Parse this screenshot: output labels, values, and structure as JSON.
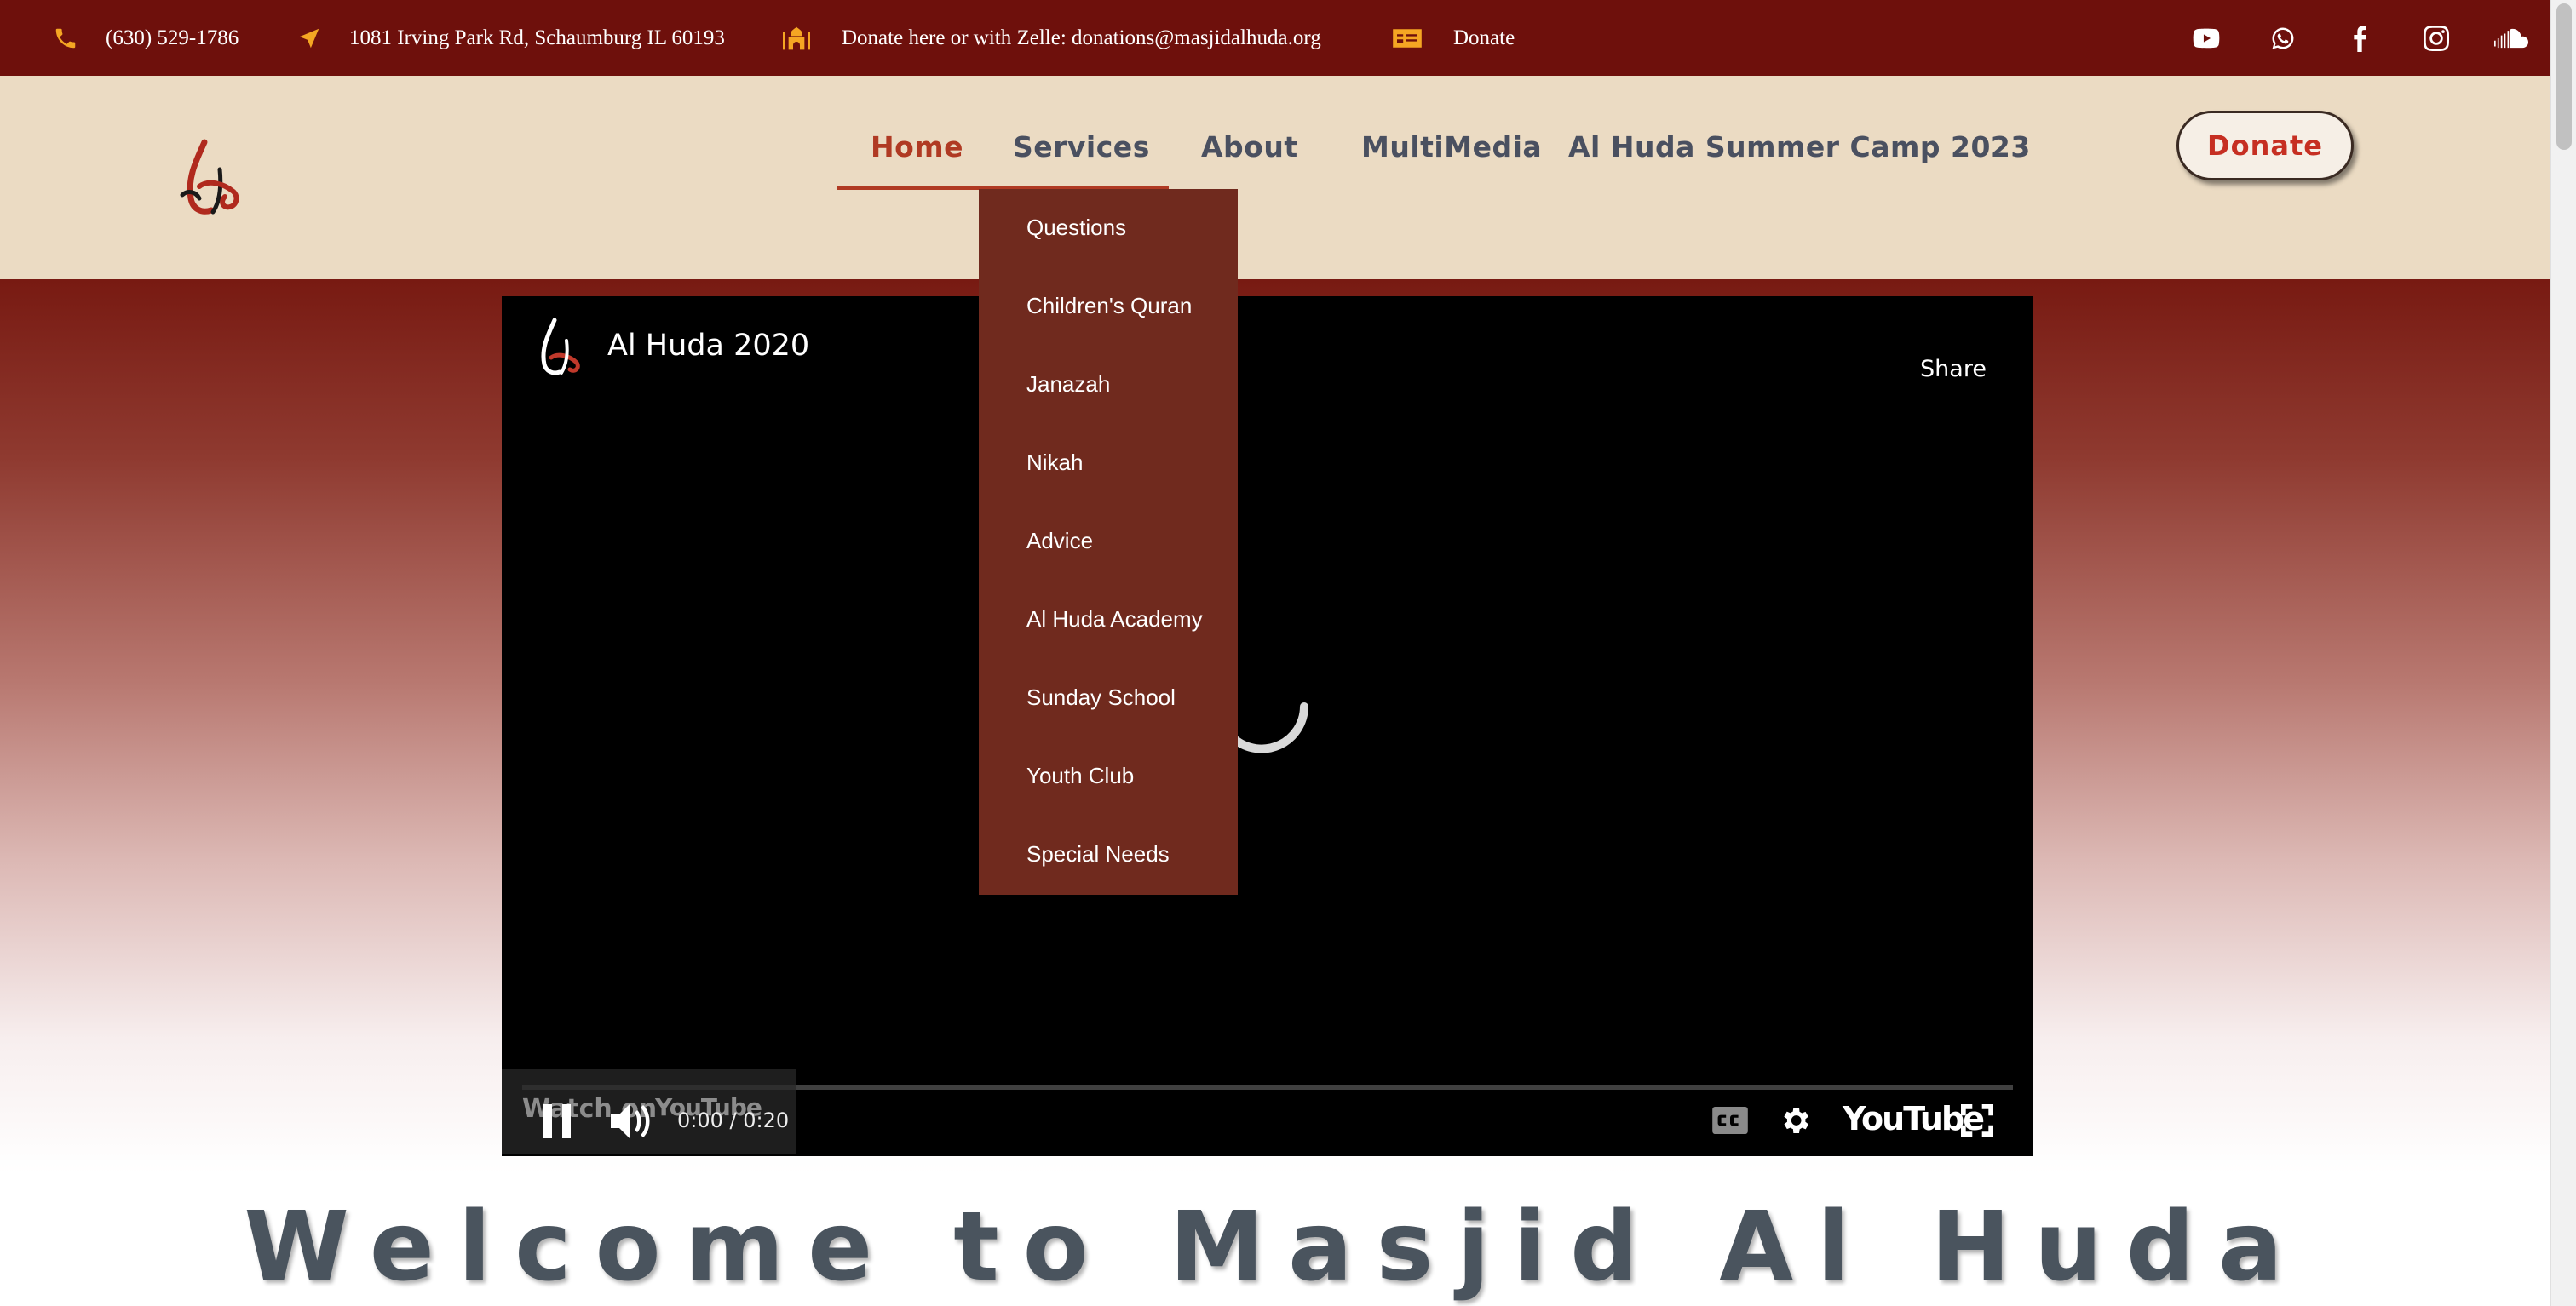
{
  "topbar": {
    "phone": "(630) 529-1786",
    "address": "1081 Irving Park Rd, Schaumburg IL 60193",
    "donate_zelle": "Donate here or with Zelle: donations@masjidalhuda.org",
    "donate_link": "Donate",
    "icons": [
      "phone-icon",
      "location-arrow-icon",
      "mosque-icon",
      "donate-card-icon"
    ],
    "social": [
      "youtube-icon",
      "whatsapp-icon",
      "facebook-icon",
      "instagram-icon",
      "soundcloud-icon"
    ],
    "colors": {
      "bar": "#6e100c",
      "icon": "#f5a623"
    }
  },
  "header": {
    "nav": [
      {
        "label": "Home",
        "active": true
      },
      {
        "label": "Services",
        "active": false
      },
      {
        "label": "About",
        "active": false
      },
      {
        "label": "MultiMedia",
        "active": false
      },
      {
        "label": "Al Huda Summer Camp 2023",
        "active": false
      }
    ],
    "donate_button": "Donate",
    "colors": {
      "background": "#ebdbc3",
      "active": "#b03a23",
      "nav": "#4a5060"
    }
  },
  "services_menu": {
    "items": [
      "Questions",
      "Children's Quran",
      "Janazah",
      "Nikah",
      "Advice",
      "Al Huda Academy",
      "Sunday School",
      "Youth Club",
      "Special Needs"
    ],
    "color": "#702a1e"
  },
  "video": {
    "title": "Al Huda 2020",
    "share": "Share",
    "watch_on": "Watch on",
    "watch_on_brand": "YouTube",
    "time": "0:00 / 0:20",
    "brand": "YouTube"
  },
  "welcome": {
    "heading": "Welcome to Masjid Al Huda"
  }
}
